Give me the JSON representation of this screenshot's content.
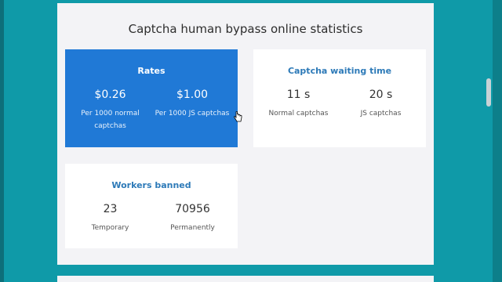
{
  "page_title": "Captcha human bypass online statistics",
  "cards": {
    "rates": {
      "title": "Rates",
      "stats": [
        {
          "value": "$0.26",
          "label": "Per 1000 normal captchas"
        },
        {
          "value": "$1.00",
          "label": "Per 1000 JS captchas"
        }
      ]
    },
    "waiting": {
      "title": "Captcha waiting time",
      "stats": [
        {
          "value": "11 s",
          "label": "Normal captchas"
        },
        {
          "value": "20 s",
          "label": "JS captchas"
        }
      ]
    },
    "banned": {
      "title": "Workers banned",
      "stats": [
        {
          "value": "23",
          "label": "Temporary"
        },
        {
          "value": "70956",
          "label": "Permanently"
        }
      ]
    }
  },
  "colors": {
    "background": "#0f9aa8",
    "rates_card": "#2079d6",
    "card_title": "#2d7ab8"
  },
  "icons": {
    "cursor": "hand-pointer-icon"
  }
}
